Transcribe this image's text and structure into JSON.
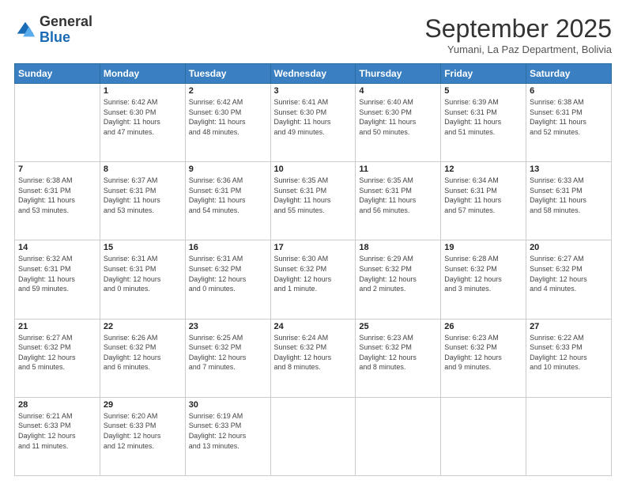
{
  "header": {
    "logo": {
      "general": "General",
      "blue": "Blue"
    },
    "title": "September 2025",
    "subtitle": "Yumani, La Paz Department, Bolivia"
  },
  "days_of_week": [
    "Sunday",
    "Monday",
    "Tuesday",
    "Wednesday",
    "Thursday",
    "Friday",
    "Saturday"
  ],
  "weeks": [
    [
      {
        "day": "",
        "info": ""
      },
      {
        "day": "1",
        "info": "Sunrise: 6:42 AM\nSunset: 6:30 PM\nDaylight: 11 hours\nand 47 minutes."
      },
      {
        "day": "2",
        "info": "Sunrise: 6:42 AM\nSunset: 6:30 PM\nDaylight: 11 hours\nand 48 minutes."
      },
      {
        "day": "3",
        "info": "Sunrise: 6:41 AM\nSunset: 6:30 PM\nDaylight: 11 hours\nand 49 minutes."
      },
      {
        "day": "4",
        "info": "Sunrise: 6:40 AM\nSunset: 6:30 PM\nDaylight: 11 hours\nand 50 minutes."
      },
      {
        "day": "5",
        "info": "Sunrise: 6:39 AM\nSunset: 6:31 PM\nDaylight: 11 hours\nand 51 minutes."
      },
      {
        "day": "6",
        "info": "Sunrise: 6:38 AM\nSunset: 6:31 PM\nDaylight: 11 hours\nand 52 minutes."
      }
    ],
    [
      {
        "day": "7",
        "info": "Sunrise: 6:38 AM\nSunset: 6:31 PM\nDaylight: 11 hours\nand 53 minutes."
      },
      {
        "day": "8",
        "info": "Sunrise: 6:37 AM\nSunset: 6:31 PM\nDaylight: 11 hours\nand 53 minutes."
      },
      {
        "day": "9",
        "info": "Sunrise: 6:36 AM\nSunset: 6:31 PM\nDaylight: 11 hours\nand 54 minutes."
      },
      {
        "day": "10",
        "info": "Sunrise: 6:35 AM\nSunset: 6:31 PM\nDaylight: 11 hours\nand 55 minutes."
      },
      {
        "day": "11",
        "info": "Sunrise: 6:35 AM\nSunset: 6:31 PM\nDaylight: 11 hours\nand 56 minutes."
      },
      {
        "day": "12",
        "info": "Sunrise: 6:34 AM\nSunset: 6:31 PM\nDaylight: 11 hours\nand 57 minutes."
      },
      {
        "day": "13",
        "info": "Sunrise: 6:33 AM\nSunset: 6:31 PM\nDaylight: 11 hours\nand 58 minutes."
      }
    ],
    [
      {
        "day": "14",
        "info": "Sunrise: 6:32 AM\nSunset: 6:31 PM\nDaylight: 11 hours\nand 59 minutes."
      },
      {
        "day": "15",
        "info": "Sunrise: 6:31 AM\nSunset: 6:31 PM\nDaylight: 12 hours\nand 0 minutes."
      },
      {
        "day": "16",
        "info": "Sunrise: 6:31 AM\nSunset: 6:32 PM\nDaylight: 12 hours\nand 0 minutes."
      },
      {
        "day": "17",
        "info": "Sunrise: 6:30 AM\nSunset: 6:32 PM\nDaylight: 12 hours\nand 1 minute."
      },
      {
        "day": "18",
        "info": "Sunrise: 6:29 AM\nSunset: 6:32 PM\nDaylight: 12 hours\nand 2 minutes."
      },
      {
        "day": "19",
        "info": "Sunrise: 6:28 AM\nSunset: 6:32 PM\nDaylight: 12 hours\nand 3 minutes."
      },
      {
        "day": "20",
        "info": "Sunrise: 6:27 AM\nSunset: 6:32 PM\nDaylight: 12 hours\nand 4 minutes."
      }
    ],
    [
      {
        "day": "21",
        "info": "Sunrise: 6:27 AM\nSunset: 6:32 PM\nDaylight: 12 hours\nand 5 minutes."
      },
      {
        "day": "22",
        "info": "Sunrise: 6:26 AM\nSunset: 6:32 PM\nDaylight: 12 hours\nand 6 minutes."
      },
      {
        "day": "23",
        "info": "Sunrise: 6:25 AM\nSunset: 6:32 PM\nDaylight: 12 hours\nand 7 minutes."
      },
      {
        "day": "24",
        "info": "Sunrise: 6:24 AM\nSunset: 6:32 PM\nDaylight: 12 hours\nand 8 minutes."
      },
      {
        "day": "25",
        "info": "Sunrise: 6:23 AM\nSunset: 6:32 PM\nDaylight: 12 hours\nand 8 minutes."
      },
      {
        "day": "26",
        "info": "Sunrise: 6:23 AM\nSunset: 6:32 PM\nDaylight: 12 hours\nand 9 minutes."
      },
      {
        "day": "27",
        "info": "Sunrise: 6:22 AM\nSunset: 6:33 PM\nDaylight: 12 hours\nand 10 minutes."
      }
    ],
    [
      {
        "day": "28",
        "info": "Sunrise: 6:21 AM\nSunset: 6:33 PM\nDaylight: 12 hours\nand 11 minutes."
      },
      {
        "day": "29",
        "info": "Sunrise: 6:20 AM\nSunset: 6:33 PM\nDaylight: 12 hours\nand 12 minutes."
      },
      {
        "day": "30",
        "info": "Sunrise: 6:19 AM\nSunset: 6:33 PM\nDaylight: 12 hours\nand 13 minutes."
      },
      {
        "day": "",
        "info": ""
      },
      {
        "day": "",
        "info": ""
      },
      {
        "day": "",
        "info": ""
      },
      {
        "day": "",
        "info": ""
      }
    ]
  ]
}
